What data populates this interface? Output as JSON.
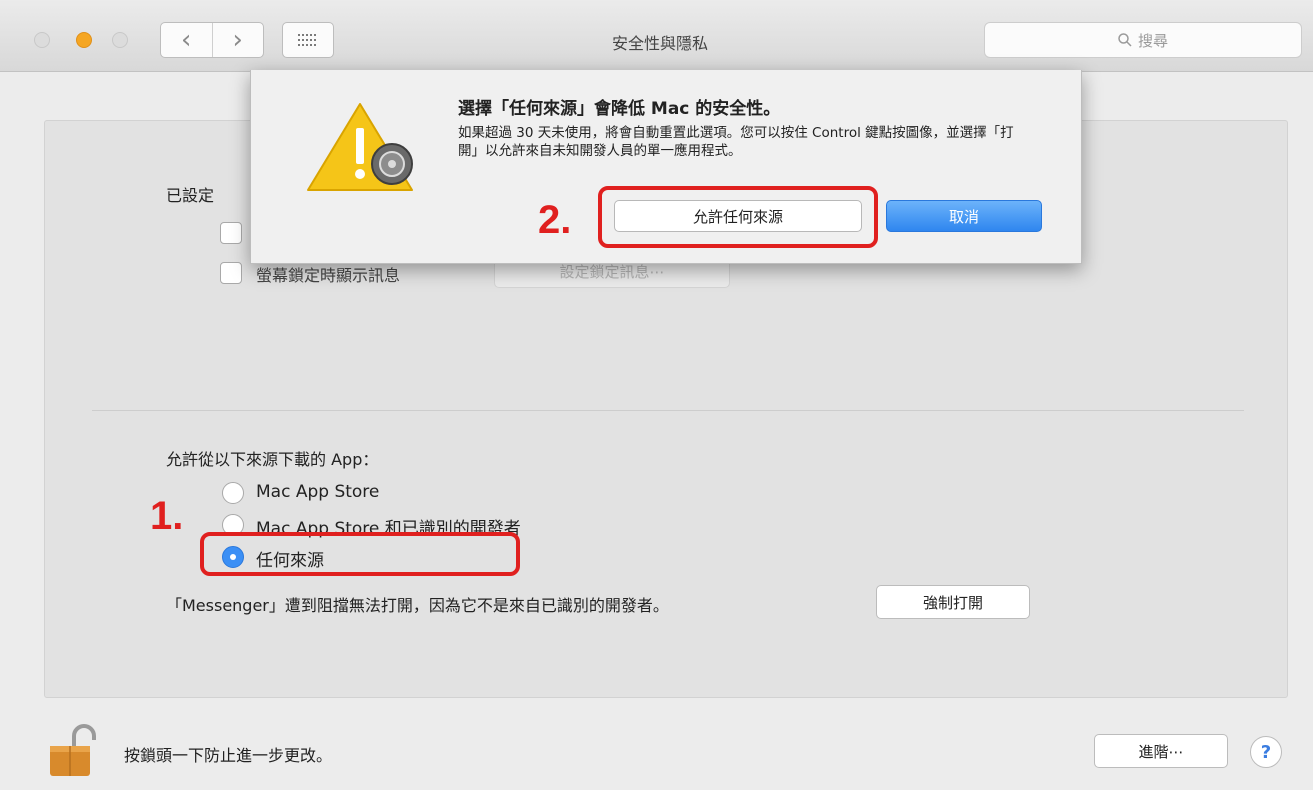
{
  "window": {
    "title": "安全性與隱私",
    "search_placeholder": "搜尋",
    "back_icon": "chevron-left-icon",
    "forward_icon": "chevron-right-icon",
    "grid_icon": "grid-icon"
  },
  "general": {
    "set_label": "已設定",
    "show_message_label": "螢幕鎖定時顯示訊息",
    "set_lock_message_button": "設定鎖定訊息⋯"
  },
  "gatekeeper": {
    "allow_label": "允許從以下來源下載的 App：",
    "options": [
      {
        "label": "Mac App Store",
        "selected": false
      },
      {
        "label": "Mac App Store 和已識別的開發者",
        "selected": false
      },
      {
        "label": "任何來源",
        "selected": true
      }
    ],
    "blocked_message": "「Messenger」遭到阻擋無法打開，因為它不是來自已識別的開發者。",
    "force_open_button": "強制打開"
  },
  "footer": {
    "lock_text": "按鎖頭一下防止進一步更改。",
    "advanced_button": "進階⋯",
    "help_button": "?"
  },
  "dialog": {
    "title": "選擇「任何來源」會降低 Mac 的安全性。",
    "body": "如果超過 30 天未使用，將會自動重置此選項。您可以按住 Control 鍵點按圖像，並選擇「打開」以允許來自未知開發人員的單一應用程式。",
    "allow_button": "允許任何來源",
    "cancel_button": "取消"
  },
  "annotations": {
    "step1": "1.",
    "step2": "2.",
    "color": "#e0201f"
  },
  "colors": {
    "accent": "#3b8ff5",
    "traffic_minimize": "#f5a623"
  }
}
